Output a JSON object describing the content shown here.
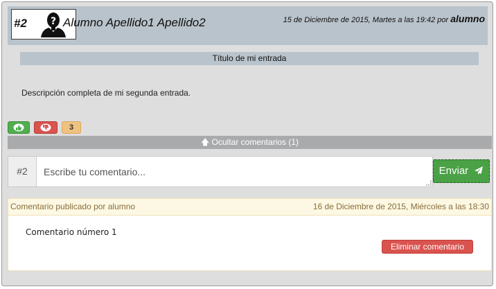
{
  "post": {
    "number": "#2",
    "author": "Alumno Apellido1 Apellido2",
    "date_text": "15 de Diciembre de 2015, Martes a las 19:42 por ",
    "user": "alumno",
    "title": "Título de mi entrada",
    "description": "Descripción completa de mi segunda entrada."
  },
  "votes": {
    "count": "3"
  },
  "comments_toggle": {
    "label": "Ocultar comentarios (1)"
  },
  "comment_form": {
    "addon": "#2",
    "placeholder": "Escribe tu comentario...",
    "send_label": "Enviar"
  },
  "comments": [
    {
      "header_left": "Comentario publicado por alumno",
      "header_right": "16 de Diciembre de 2015, Miércoles a las 18:30",
      "text": "Comentario número 1",
      "delete_label": "Eliminar comentario"
    }
  ],
  "colors": {
    "header_bg": "#b9c3cb",
    "like": "#4fae4d",
    "dislike": "#d9534f",
    "count_badge": "#f0c281",
    "send": "#4aa146",
    "delete": "#d9534f"
  }
}
